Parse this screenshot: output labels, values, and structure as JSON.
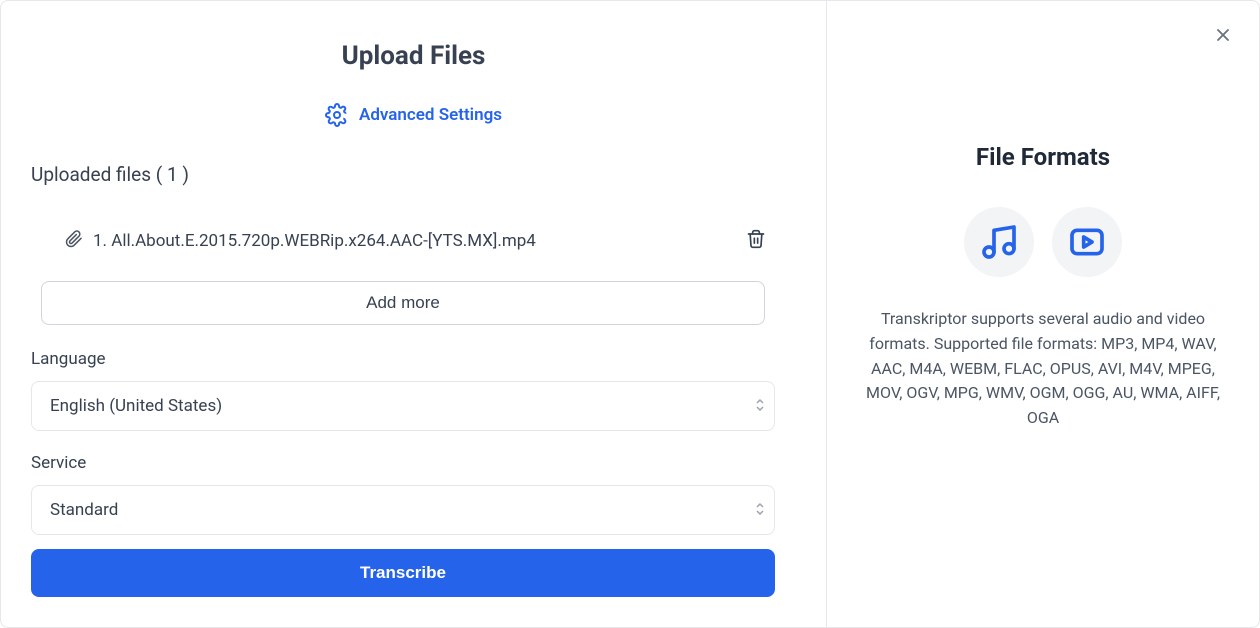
{
  "header": {
    "title": "Upload Files",
    "advanced_settings_label": "Advanced Settings"
  },
  "uploads": {
    "section_label": "Uploaded files ( 1 )",
    "count": 1,
    "files": [
      {
        "index": 1,
        "name": "1. All.About.E.2015.720p.WEBRip.x264.AAC-[YTS.MX].mp4"
      }
    ],
    "add_more_label": "Add more"
  },
  "form": {
    "language_label": "Language",
    "language_value": "English (United States)",
    "service_label": "Service",
    "service_value": "Standard",
    "submit_label": "Transcribe"
  },
  "sidebar": {
    "title": "File Formats",
    "description": "Transkriptor supports several audio and video formats. Supported file formats: MP3, MP4, WAV, AAC, M4A, WEBM, FLAC, OPUS, AVI, M4V, MPEG, MOV, OGV, MPG, WMV, OGM, OGG, AU, WMA, AIFF, OGA"
  },
  "icons": {
    "gear": "gear-icon",
    "paperclip": "paperclip-icon",
    "trash": "trash-icon",
    "music": "music-note-icon",
    "video": "video-play-icon",
    "close": "close-icon"
  },
  "colors": {
    "accent": "#2563eb",
    "text": "#374151",
    "border": "#e5e7eb"
  }
}
